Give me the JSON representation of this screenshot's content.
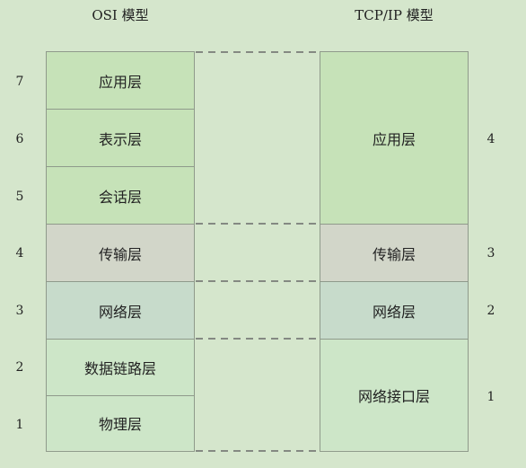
{
  "osi": {
    "title": "OSI 模型",
    "layers": [
      {
        "name": "应用层",
        "number": "7"
      },
      {
        "name": "表示层",
        "number": "6"
      },
      {
        "name": "会话层",
        "number": "5"
      },
      {
        "name": "传输层",
        "number": "4"
      },
      {
        "name": "网络层",
        "number": "3"
      },
      {
        "name": "数据链路层",
        "number": "2"
      },
      {
        "name": "物理层",
        "number": "1"
      }
    ]
  },
  "tcpip": {
    "title": "TCP/IP 模型",
    "layers": [
      {
        "name": "应用层",
        "number": "4"
      },
      {
        "name": "传输层",
        "number": "3"
      },
      {
        "name": "网络层",
        "number": "2"
      },
      {
        "name": "网络接口层",
        "number": "1"
      }
    ]
  },
  "colors": {
    "background": "#d5e6cc",
    "application": "#c6e2b8",
    "transport": "#d2d6c9",
    "network": "#c7dbcb",
    "link": "#cde6c8",
    "border": "#8f9a8b",
    "dash": "#6a6a6a"
  }
}
